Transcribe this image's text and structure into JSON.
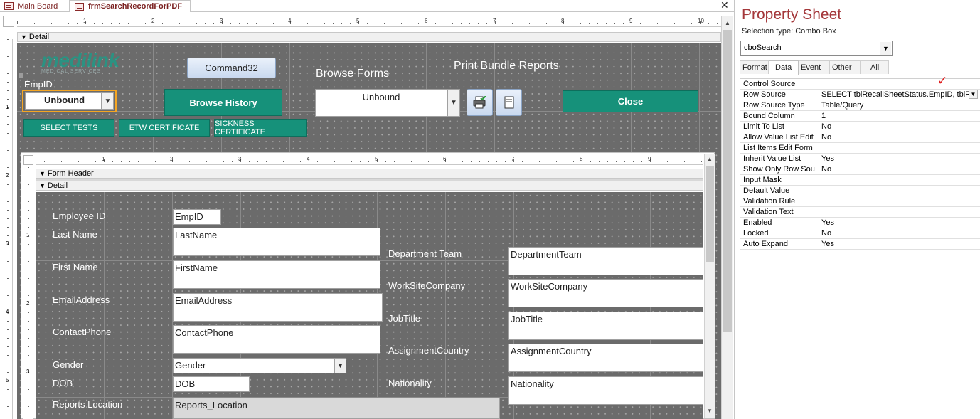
{
  "tabs": [
    {
      "label": "Main Board",
      "active": false
    },
    {
      "label": "frmSearchRecordForPDF",
      "active": true
    }
  ],
  "close_glyph": "✕",
  "sections": {
    "outer_detail": "Detail",
    "subform_header": "Form Header",
    "subform_detail": "Detail"
  },
  "ruler": {
    "outer_numbers": [
      "1",
      "2",
      "3",
      "4",
      "5",
      "6",
      "7",
      "8",
      "9",
      "10"
    ],
    "inner_numbers": [
      "1",
      "2",
      "3",
      "4",
      "5",
      "6",
      "7",
      "8",
      "9"
    ],
    "vertical_outer": [
      "1",
      "2",
      "3",
      "4",
      "5"
    ],
    "vertical_inner": [
      "1",
      "2",
      "3"
    ]
  },
  "logo": {
    "text": "medilink",
    "tagline": "MEDICAL SERVICES"
  },
  "header_controls": {
    "empid_label": "EmpID",
    "empid_combo_value": "Unbound",
    "command32": "Command32",
    "browse_forms_label": "Browse Forms",
    "print_bundle_label": "Print Bundle Reports",
    "browse_forms_combo_value": "Unbound",
    "browse_history": "Browse History",
    "close": "Close",
    "select_tests": "SELECT TESTS",
    "etw_certificate": "ETW CERTIFICATE",
    "sickness_certificate": "SICKNESS CERTIFICATE"
  },
  "subform_fields_left": [
    {
      "label": "Employee ID",
      "control": "EmpID"
    },
    {
      "label": "Last Name",
      "control": "LastName"
    },
    {
      "label": "First Name",
      "control": "FirstName"
    },
    {
      "label": "EmailAddress",
      "control": "EmailAddress"
    },
    {
      "label": "ContactPhone",
      "control": "ContactPhone"
    },
    {
      "label": "Gender",
      "control": "Gender"
    },
    {
      "label": "DOB",
      "control": "DOB"
    },
    {
      "label": "Reports Location",
      "control": "Reports_Location"
    }
  ],
  "subform_fields_right": [
    {
      "label": "Department Team",
      "control": "DepartmentTeam"
    },
    {
      "label": "WorkSiteCompany",
      "control": "WorkSiteCompany"
    },
    {
      "label": "JobTitle",
      "control": "JobTitle"
    },
    {
      "label": "AssignmentCountry",
      "control": "AssignmentCountry"
    },
    {
      "label": "Nationality",
      "control": "Nationality"
    }
  ],
  "property_sheet": {
    "title": "Property Sheet",
    "selection_type": "Selection type:  Combo Box",
    "selected_object": "cboSearch",
    "tabs": [
      "Format",
      "Data",
      "Event",
      "Other",
      "All"
    ],
    "active_tab": "Data",
    "check_glyph": "✓",
    "rows": [
      {
        "name": "Control Source",
        "value": ""
      },
      {
        "name": "Row Source",
        "value": "SELECT tblRecallSheetStatus.EmpID, tblR"
      },
      {
        "name": "Row Source Type",
        "value": "Table/Query"
      },
      {
        "name": "Bound Column",
        "value": "1"
      },
      {
        "name": "Limit To List",
        "value": "No"
      },
      {
        "name": "Allow Value List Edit",
        "value": "No"
      },
      {
        "name": "List Items Edit Form",
        "value": ""
      },
      {
        "name": "Inherit Value List",
        "value": "Yes"
      },
      {
        "name": "Show Only Row Sou",
        "value": "No"
      },
      {
        "name": "Input Mask",
        "value": ""
      },
      {
        "name": "Default Value",
        "value": ""
      },
      {
        "name": "Validation Rule",
        "value": ""
      },
      {
        "name": "Validation Text",
        "value": ""
      },
      {
        "name": "Enabled",
        "value": "Yes"
      },
      {
        "name": "Locked",
        "value": "No"
      },
      {
        "name": "Auto Expand",
        "value": "Yes"
      }
    ]
  },
  "colors": {
    "design_bg": "#6b6b6b",
    "button_green": "#16917a",
    "property_title": "#a4373a",
    "selection_outline": "#f5a623"
  }
}
